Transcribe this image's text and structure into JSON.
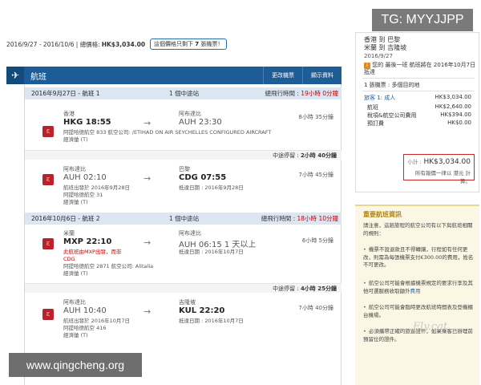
{
  "top_summary": {
    "dates": "2016/9/27 - 2016/10/6",
    "total_label": "總價格:",
    "total_price": "HK$3,034.00",
    "seats_prefix": "這個價格只剩下",
    "seats_count": "7",
    "seats_suffix": "張機票！"
  },
  "panel": {
    "title": "航班",
    "change_label": "更改機票",
    "show_label": "顯示資料"
  },
  "outbound": {
    "header_date": "2016年9月27日 - 航班 1",
    "header_stops": "1 個中途站",
    "header_total_label": "總飛行時間 :",
    "header_total_time": "19小時 0分鐘",
    "seg1": {
      "dep_airport": "香港",
      "dep_time": "HKG 18:55",
      "arr_airport": "阿布達比",
      "arr_time": "AUH 23:30",
      "duration": "8小時 35分鐘",
      "operator": "阿提哈德航空 833 航空公司: /ETIHAD ON AIR SEYCHELLES CONFIGURED AIRCRAFT",
      "cabin": "經濟艙 (T)"
    },
    "layover_label": "中途停留 :",
    "layover_time": "2小時 40分鐘",
    "seg2": {
      "dep_airport": "阿布達比",
      "dep_time": "AUH 02:10",
      "dep_date": "航班出發於 2016年9月28日",
      "arr_airport": "巴黎",
      "arr_time": "CDG 07:55",
      "arr_date": "抵達日期 : 2016年9月28日",
      "duration": "7小時 45分鐘",
      "operator": "阿提哈德航空 31",
      "cabin": "經濟艙 (T)"
    }
  },
  "return": {
    "header_date": "2016年10月6日 - 航班 2",
    "header_stops": "1 個中途站",
    "header_total_label": "總飛行時間 :",
    "header_total_time": "18小時 10分鐘",
    "seg1": {
      "dep_airport": "米蘭",
      "dep_time": "MXP 22:10",
      "dep_warning": "此航班由MXP出發，而非",
      "dep_warning2": "CDG",
      "arr_airport": "阿布達比",
      "arr_time": "AUH 06:15 1 天以上",
      "arr_date": "抵達日期 : 2016年10月7日",
      "duration": "6小時 5分鐘",
      "operator": "阿提哈德航空 2871 航空公司: Alitalia",
      "cabin": "經濟艙 (T)"
    },
    "layover_label": "中途停留 :",
    "layover_time": "4小時 25分鐘",
    "seg2": {
      "dep_airport": "阿布達比",
      "dep_time": "AUH 10:40",
      "dep_date": "航班出發於 2016年10月7日",
      "arr_airport": "吉隆坡",
      "arr_time": "KUL 22:20",
      "arr_date": "抵達日期 : 2016年10月7日",
      "duration": "7小時 40分鐘",
      "operator": "阿提哈德航空 416",
      "cabin": "經濟艙 (T)"
    }
  },
  "sidebar": {
    "route_line1": "香港 到 巴黎",
    "route_line2": "米蘭 到 吉隆坡",
    "route_date": "2016/9/27",
    "notice_icon": "i",
    "notice_text": "您的 最後一班 航班將在 2016年10月7日 抵達",
    "ticket_line": "1 張機票 : 多個目的地",
    "adult_label": "旅客 1: 成人",
    "adult_price": "HK$3,034.00",
    "airfare_label": "航班",
    "airfare_price": "HK$2,640.00",
    "tax_label": "稅項&航空公司費用",
    "tax_price": "HK$394.00",
    "booking_label": "預訂費",
    "booking_price": "HK$0.00",
    "subtotal_label": "小計 :",
    "subtotal_price": "HK$3,034.00",
    "subtotal_note": "所有報價一律以 港元 計算。"
  },
  "important": {
    "title": "重要航班資訊",
    "intro": "請注意，這趟旅程的航空公司有以下與航班相關的規則：",
    "bullet1": "機票不設退款且不得轉讓，行程如有任何更改，則需為每張機票支付€300.00的費用，姓名不可更改。",
    "bullet2_a": "航空公司可能會根據機票規定的要求行李及其他可選服務收取額外",
    "bullet2_link": "費用",
    "bullet3": "航空公司可能會臨時更改航班時間表及登機櫃台機場。",
    "bullet4": "必須攜帶正確的旅遊證件，如果乘客已辦理前預留位的證件。"
  },
  "overlays": {
    "tg_label": "TG: MYYJJPP",
    "site_label": "www.qingcheng.org",
    "sig_label": "Fly.cat"
  },
  "icons": {
    "airplane": "airplane-icon",
    "arrow": "arrow-right-icon",
    "airline": "etihad-logo-icon",
    "info": "info-icon"
  },
  "colors": {
    "header_blue": "#1d5c96",
    "section_blue": "#dce6f2",
    "warning_red": "#c00000",
    "highlight_red": "#c62828",
    "notice_bg": "#fbf7e4"
  }
}
